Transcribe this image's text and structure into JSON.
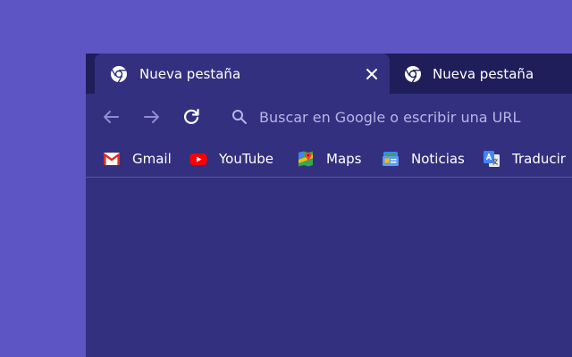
{
  "tabs": [
    {
      "title": "Nueva pestaña",
      "icon": "chrome-icon",
      "active": true
    },
    {
      "title": "Nueva pestaña",
      "icon": "chrome-icon",
      "active": false
    }
  ],
  "toolbar": {
    "back_icon": "back-arrow-icon",
    "forward_icon": "forward-arrow-icon",
    "reload_icon": "reload-icon",
    "search_placeholder": "Buscar en Google o escribir una URL"
  },
  "bookmarks": [
    {
      "label": "Gmail",
      "icon": "gmail-icon"
    },
    {
      "label": "YouTube",
      "icon": "youtube-icon"
    },
    {
      "label": "Maps",
      "icon": "maps-icon"
    },
    {
      "label": "Noticias",
      "icon": "news-icon"
    },
    {
      "label": "Traducir",
      "icon": "translate-icon"
    }
  ],
  "colors": {
    "desktop": "#5d55c4",
    "window": "#33307f",
    "tabstrip": "#201e5a",
    "text": "#ffffff",
    "muted": "#b8b5e6"
  }
}
